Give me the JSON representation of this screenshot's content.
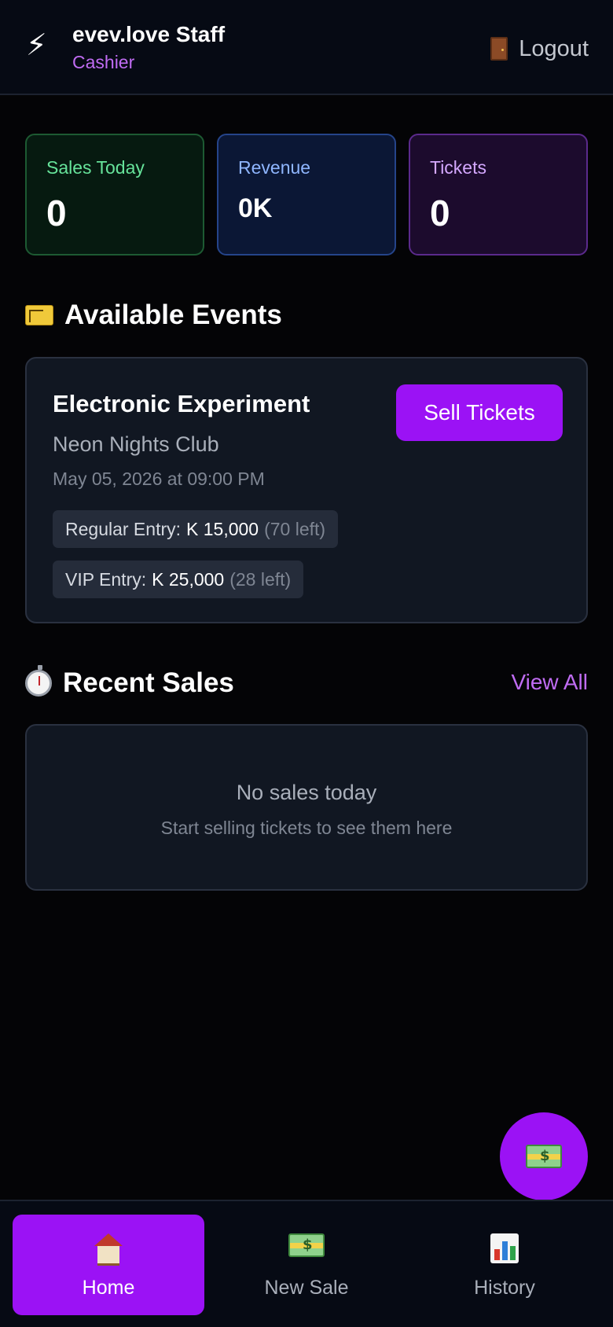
{
  "header": {
    "brand_icon": "lightning-icon",
    "app_name": "evev.love Staff",
    "role": "Cashier",
    "logout_label": "Logout",
    "logout_icon": "door-icon"
  },
  "stats": {
    "sales_today": {
      "label": "Sales Today",
      "value": "0"
    },
    "revenue": {
      "label": "Revenue",
      "value": "0K"
    },
    "tickets": {
      "label": "Tickets",
      "value": "0"
    }
  },
  "events_section": {
    "icon": "ticket-icon",
    "title": "Available Events"
  },
  "event": {
    "title": "Electronic Experiment",
    "venue": "Neon Nights Club",
    "datetime": "May 05, 2026 at 09:00 PM",
    "sell_label": "Sell Tickets",
    "tiers": [
      {
        "label": "Regular Entry:",
        "price": "K 15,000",
        "left": "(70 left)"
      },
      {
        "label": "VIP Entry:",
        "price": "K 25,000",
        "left": "(28 left)"
      }
    ]
  },
  "recent_sales": {
    "icon": "stopwatch-icon",
    "title": "Recent Sales",
    "view_all": "View All",
    "empty_title": "No sales today",
    "empty_subtitle": "Start selling tickets to see them here"
  },
  "fab": {
    "icon": "money-icon"
  },
  "bottom_nav": {
    "items": [
      {
        "label": "Home",
        "icon": "house-icon",
        "active": true
      },
      {
        "label": "New Sale",
        "icon": "money-icon",
        "active": false
      },
      {
        "label": "History",
        "icon": "bar-chart-icon",
        "active": false
      }
    ]
  },
  "colors": {
    "accent": "#9b12f5",
    "role_text": "#c06cf3",
    "background": "#040406",
    "card": "#111722"
  }
}
